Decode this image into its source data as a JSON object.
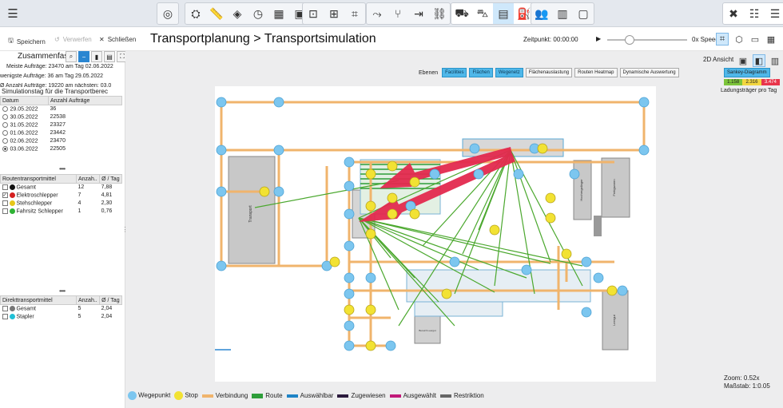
{
  "toolbar": {
    "menu_icon": "hamburger-icon",
    "groups": [
      [
        "radar-icon"
      ],
      [
        "truck-settings-icon",
        "ruler-icon",
        "shapes-icon",
        "clock-icon",
        "calendar-icon",
        "product-icon"
      ],
      [
        "frame-icon",
        "grid-icon",
        "crop-icon"
      ],
      [
        "route-icon",
        "branch-icon",
        "merge-icon",
        "link-icon"
      ],
      [
        "conveyor-icon",
        "forklift-icon",
        "chart-grid-icon",
        "vehicle-icon"
      ],
      [
        "people-icon",
        "stack-icon",
        "box-icon"
      ],
      [
        "alert-icon",
        "sliders-icon",
        "list-icon"
      ]
    ]
  },
  "subbar": {
    "save": "Speichern",
    "discard": "Verwerfen",
    "close": "Schließen",
    "breadcrumb_root": "Transportplanung",
    "breadcrumb_sep": ">",
    "breadcrumb_page": "Transportsimulation",
    "time_label": "Zeitpunkt:",
    "time_value": "00:00:00",
    "speed": "0x Speed"
  },
  "summary": {
    "title": "Zusammenfas",
    "most": "Meiste Aufträge: 23470 am Tag 02.06.2022",
    "least": "wenigste Aufträge: 36 am Tag 29.05.2022",
    "next": "Ø Anzahl Aufträge: 19220 am nächsten: 03.0",
    "sim_day": "Simulationstag für die Transportberec"
  },
  "days_table": {
    "headers": [
      "Datum",
      "Anzahl Aufträge"
    ],
    "rows": [
      {
        "date": "29.05.2022",
        "count": "36",
        "selected": false
      },
      {
        "date": "30.05.2022",
        "count": "22538",
        "selected": false
      },
      {
        "date": "31.05.2022",
        "count": "23327",
        "selected": false
      },
      {
        "date": "01.06.2022",
        "count": "23442",
        "selected": false
      },
      {
        "date": "02.06.2022",
        "count": "23470",
        "selected": false
      },
      {
        "date": "03.06.2022",
        "count": "22505",
        "selected": true
      }
    ]
  },
  "route_table": {
    "headers": [
      "Routentransportmittel",
      "Anzah..",
      "Ø / Tag"
    ],
    "rows": [
      {
        "name": "Gesamt",
        "count": "12",
        "avg": "7,88",
        "color": "#111111",
        "checked": false
      },
      {
        "name": "Elektroschlepper",
        "count": "7",
        "avg": "4,81",
        "color": "#d42020",
        "checked": true
      },
      {
        "name": "Stehschlepper",
        "count": "4",
        "avg": "2,30",
        "color": "#e6c619",
        "checked": false
      },
      {
        "name": "Fahrsitz Schlepper",
        "count": "1",
        "avg": "0,76",
        "color": "#2fb335",
        "checked": false
      }
    ]
  },
  "direct_table": {
    "headers": [
      "Direkttransportmittel",
      "Anzah..",
      "Ø / Tag"
    ],
    "rows": [
      {
        "name": "Gesamt",
        "count": "5",
        "avg": "2,04",
        "color": "#777777"
      },
      {
        "name": "Stapler",
        "count": "5",
        "avg": "2,04",
        "color": "#21c0d6"
      }
    ]
  },
  "view": {
    "mode": "2D Ansicht",
    "layers_label": "Ebenen",
    "layers": [
      {
        "label": "Facilities",
        "on": true
      },
      {
        "label": "Flächen",
        "on": true
      },
      {
        "label": "Wegenetz",
        "on": true
      },
      {
        "label": "Flächenauslastung",
        "on": false
      },
      {
        "label": "Routen Heatmap",
        "on": false
      },
      {
        "label": "Dynamische Auswertung",
        "on": false
      }
    ],
    "sankey": "Sankey-Diagramm",
    "colorbar": [
      "1.158",
      "2.316",
      "3.474"
    ],
    "carrier_label": "Ladungsträger pro Tag",
    "zoom": "Zoom: 0.52x",
    "scale": "Maßstab: 1:0.05"
  },
  "plan_labels": {
    "area_left": "Transport",
    "area_right1": "Hochregallager",
    "area_right2": "Fertigwaren",
    "area_right3": "Leergut",
    "area_bottom": "Bereich Leergut"
  },
  "legend": [
    {
      "label": "Wegepunkt",
      "kind": "circle",
      "color": "#7cc6ef"
    },
    {
      "label": "Stop",
      "kind": "circle",
      "color": "#f2e233"
    },
    {
      "label": "Verbindung",
      "kind": "line",
      "color": "#f0b46c"
    },
    {
      "label": "Route",
      "kind": "line",
      "color": "#2e9e3a"
    },
    {
      "label": "Auswählbar",
      "kind": "line",
      "color": "#1f84c6"
    },
    {
      "label": "Zugewiesen",
      "kind": "line",
      "color": "#2b1a3d"
    },
    {
      "label": "Ausgewählt",
      "kind": "line",
      "color": "#c1197a"
    },
    {
      "label": "Restriktion",
      "kind": "line",
      "color": "#666666"
    }
  ]
}
